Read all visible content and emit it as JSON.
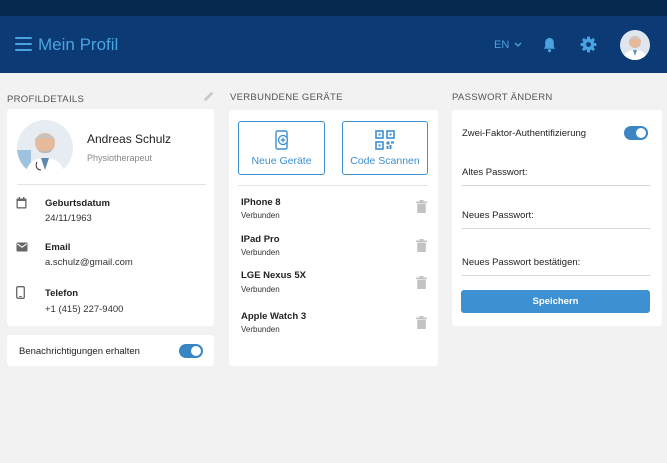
{
  "header": {
    "title": "Mein Profil",
    "language": "EN",
    "icons": [
      "menu-icon",
      "chevron-down-icon",
      "bell-icon",
      "gear-icon",
      "avatar"
    ]
  },
  "profile": {
    "section_title": "PROFILDETAILS",
    "name": "Andreas Schulz",
    "role": "Physiotherapeut",
    "fields": [
      {
        "icon": "calendar-icon",
        "label": "Geburtsdatum",
        "value": "24/11/1963"
      },
      {
        "icon": "mail-icon",
        "label": "Email",
        "value": "a.schulz@gmail.com"
      },
      {
        "icon": "phone-icon",
        "label": "Telefon",
        "value": "+1 (415) 227-9400"
      }
    ],
    "notifications_label": "Benachrichtigungen erhalten",
    "notifications_on": true
  },
  "devices": {
    "section_title": "VERBUNDENE GERÄTE",
    "new_device_label": "Neue Geräte",
    "scan_code_label": "Code Scannen",
    "items": [
      {
        "name": "IPhone 8",
        "status": "Verbunden"
      },
      {
        "name": "IPad Pro",
        "status": "Verbunden"
      },
      {
        "name": "LGE Nexus 5X",
        "status": "Verbunden"
      },
      {
        "name": "Apple Watch 3",
        "status": "Verbunden"
      }
    ]
  },
  "password": {
    "section_title": "PASSWORT ÄNDERN",
    "two_factor_label": "Zwei-Faktor-Authentifizierung",
    "two_factor_on": true,
    "old_label": "Altes Passwort:",
    "new_label": "Neues Passwort:",
    "confirm_label": "Neues Passwort bestätigen:",
    "save_label": "Speichern"
  },
  "colors": {
    "topbar": "#07284f",
    "appbar": "#0b3a75",
    "accent": "#3d91d3",
    "header_text": "#4aa3e0"
  }
}
